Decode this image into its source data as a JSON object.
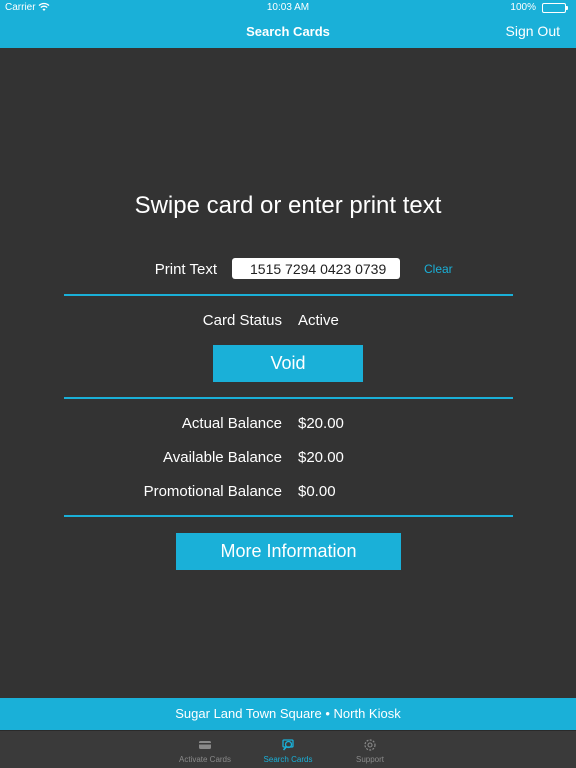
{
  "status_bar": {
    "carrier": "Carrier",
    "time": "10:03 AM",
    "battery": "100%"
  },
  "nav": {
    "title": "Search Cards",
    "sign_out": "Sign Out"
  },
  "prompt": "Swipe card or enter print text",
  "print_text": {
    "label": "Print Text",
    "value": "1515 7294 0423 0739",
    "clear": "Clear"
  },
  "card_status": {
    "label": "Card Status",
    "value": "Active"
  },
  "void_button": "Void",
  "balances": [
    {
      "label": "Actual Balance",
      "value": "$20.00"
    },
    {
      "label": "Available Balance",
      "value": "$20.00"
    },
    {
      "label": "Promotional Balance",
      "value": "$0.00"
    }
  ],
  "more_button": "More Information",
  "location": "Sugar Land Town Square • North Kiosk",
  "tabs": [
    {
      "label": "Activate Cards",
      "icon": "card-icon",
      "active": false
    },
    {
      "label": "Search Cards",
      "icon": "search-card-icon",
      "active": true
    },
    {
      "label": "Support",
      "icon": "gear-icon",
      "active": false
    }
  ],
  "colors": {
    "accent": "#1ab0d8",
    "background": "#333333",
    "battery": "#4cd964"
  }
}
